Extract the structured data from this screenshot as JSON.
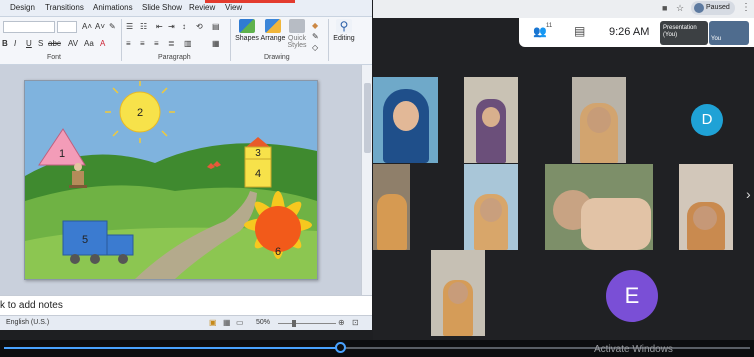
{
  "ppt": {
    "tabs": [
      "Design",
      "Transitions",
      "Animations",
      "Slide Show",
      "Review",
      "View"
    ],
    "ribbon_groups": {
      "font": "Font",
      "paragraph": "Paragraph",
      "drawing": "Drawing"
    },
    "font_buttons": [
      "B",
      "I",
      "U",
      "S",
      "abc"
    ],
    "big_buttons": {
      "shapes": "Shapes",
      "arrange": "Arrange",
      "quick_styles": "Quick Styles",
      "editing": "Editing"
    },
    "notes_placeholder": "k to add notes",
    "status_language": "English (U.S.)",
    "zoom": "50%",
    "slide_labels": [
      "1",
      "2",
      "3",
      "4",
      "5",
      "6"
    ],
    "colors": {
      "sky": "#6a9bc8",
      "grass": "#5a9a3a",
      "sun": "#f7e24a",
      "triangle": "#f39cb8",
      "roof": "#e85a2a",
      "house": "#f7e24a",
      "truck": "#3b7bd0",
      "flower": "#f25a1a"
    }
  },
  "meet": {
    "paused": "Paused",
    "time": "9:26 AM",
    "participant_count": "11",
    "presentation_label": "Presentation (You)",
    "you_label": "You",
    "avatars": [
      {
        "initial": "D",
        "color": "#1fa2d6"
      },
      {
        "initial": "E",
        "color": "#7a4fd6"
      }
    ]
  },
  "watermark": "Activate Windows",
  "media": {
    "progress": 0.45
  }
}
